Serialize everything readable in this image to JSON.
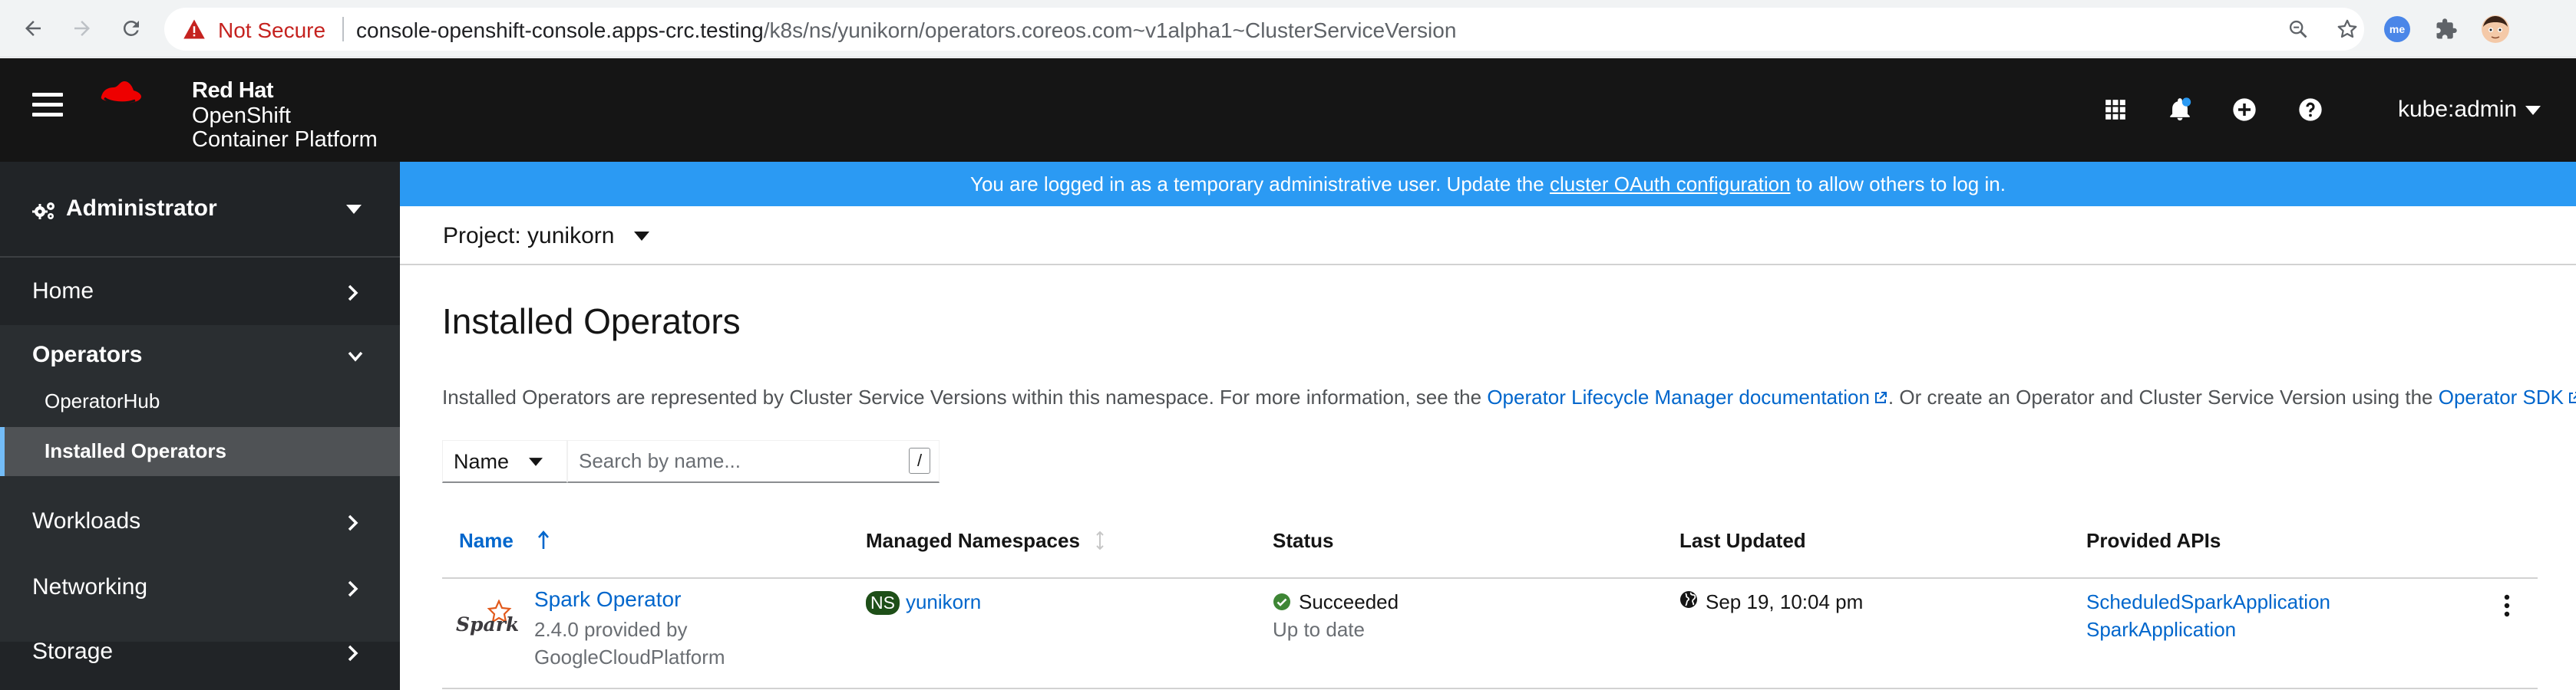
{
  "browser": {
    "security_label": "Not Secure",
    "url_host": "console-openshift-console.apps-crc.testing",
    "url_path": "/k8s/ns/yunikorn/operators.coreos.com~v1alpha1~ClusterServiceVersion",
    "extension_badge": "me"
  },
  "masthead": {
    "brand_line1": "Red Hat",
    "brand_line2": "OpenShift",
    "brand_line3": "Container Platform",
    "user": "kube:admin",
    "notification_dot_color": "#2b9af3"
  },
  "sidebar": {
    "perspective": "Administrator",
    "items": [
      {
        "label": "Home"
      },
      {
        "label": "Operators",
        "expanded": true,
        "children": [
          {
            "label": "OperatorHub"
          },
          {
            "label": "Installed Operators",
            "active": true
          }
        ]
      },
      {
        "label": "Workloads"
      },
      {
        "label": "Networking"
      },
      {
        "label": "Storage"
      }
    ]
  },
  "banner": {
    "prefix": "You are logged in as a temporary administrative user. Update the ",
    "link": "cluster OAuth configuration",
    "suffix": " to allow others to log in."
  },
  "project": {
    "label": "Project: yunikorn"
  },
  "page": {
    "title": "Installed Operators",
    "desc_prefix": "Installed Operators are represented by Cluster Service Versions within this namespace. For more information, see the ",
    "desc_link1": "Operator Lifecycle Manager documentation",
    "desc_middle": ". Or create an Operator and Cluster Service Version using the ",
    "desc_link2": "Operator SDK",
    "desc_suffix": "."
  },
  "filter": {
    "type": "Name",
    "placeholder": "Search by name...",
    "shortcut": "/"
  },
  "table": {
    "columns": [
      "Name",
      "Managed Namespaces",
      "Status",
      "Last Updated",
      "Provided APIs"
    ],
    "sorted_column": "Name",
    "rows": [
      {
        "logo_text": "Spark",
        "name": "Spark Operator",
        "version_line": "2.4.0 provided by",
        "provider": "GoogleCloudPlatform",
        "namespace_badge": "NS",
        "namespace": "yunikorn",
        "status": "Succeeded",
        "status_detail": "Up to date",
        "status_color": "#3e8635",
        "last_updated": "Sep 19, 10:04 pm",
        "apis": [
          "ScheduledSparkApplication",
          "SparkApplication"
        ]
      }
    ]
  }
}
